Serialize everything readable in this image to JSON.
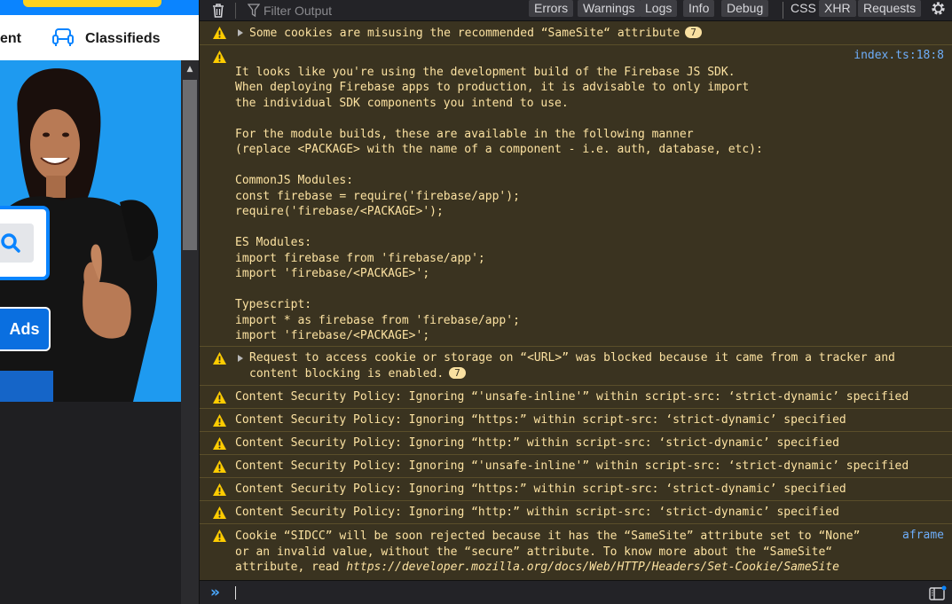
{
  "webpage": {
    "nav": {
      "item_partial": "ent",
      "classifieds": "Classifieds"
    },
    "ads_button": "Ads"
  },
  "console": {
    "filter_placeholder": "Filter Output",
    "toolbar_buttons": [
      "Errors",
      "Warnings",
      "Logs",
      "Info",
      "Debug",
      "CSS",
      "XHR",
      "Requests"
    ],
    "messages": [
      {
        "text": "Some cookies are misusing the recommended “SameSite“ attribute",
        "badge": "7",
        "source": ""
      },
      {
        "text": "\nIt looks like you're using the development build of the Firebase JS SDK.\nWhen deploying Firebase apps to production, it is advisable to only import\nthe individual SDK components you intend to use.\n\nFor the module builds, these are available in the following manner\n(replace <PACKAGE> with the name of a component - i.e. auth, database, etc):\n\nCommonJS Modules:\nconst firebase = require('firebase/app');\nrequire('firebase/<PACKAGE>');\n\nES Modules:\nimport firebase from 'firebase/app';\nimport 'firebase/<PACKAGE>';\n\nTypescript:\nimport * as firebase from 'firebase/app';\nimport 'firebase/<PACKAGE>';",
        "badge": "",
        "source": "index.ts:18:8"
      },
      {
        "text": "Request to access cookie or storage on “<URL>” was blocked because it came from a tracker and\ncontent blocking is enabled.",
        "badge": "7",
        "source": ""
      },
      {
        "text": "Content Security Policy: Ignoring “'unsafe-inline'” within script-src: ‘strict-dynamic’ specified",
        "badge": "",
        "source": ""
      },
      {
        "text": "Content Security Policy: Ignoring “https:” within script-src: ‘strict-dynamic’ specified",
        "badge": "",
        "source": ""
      },
      {
        "text": "Content Security Policy: Ignoring “http:” within script-src: ‘strict-dynamic’ specified",
        "badge": "",
        "source": ""
      },
      {
        "text": "Content Security Policy: Ignoring “'unsafe-inline'” within script-src: ‘strict-dynamic’ specified",
        "badge": "",
        "source": ""
      },
      {
        "text": "Content Security Policy: Ignoring “https:” within script-src: ‘strict-dynamic’ specified",
        "badge": "",
        "source": ""
      },
      {
        "text": "Content Security Policy: Ignoring “http:” within script-src: ‘strict-dynamic’ specified",
        "badge": "",
        "source": ""
      },
      {
        "text": "Cookie “SIDCC” will be soon rejected because it has the “SameSite” attribute set to “None”\nor an invalid value, without the “secure” attribute. To know more about the “SameSite“\nattribute, read ",
        "url": "https://developer.mozilla.org/docs/Web/HTTP/Headers/Set-Cookie/SameSite",
        "badge": "",
        "source": "aframe"
      }
    ]
  },
  "colors": {
    "warning_bg": "#3a3320",
    "warning_text": "#fce2a1",
    "link": "#6eaefa",
    "accent_blue": "#0a84ff",
    "hero_bg": "#1e9af0"
  }
}
